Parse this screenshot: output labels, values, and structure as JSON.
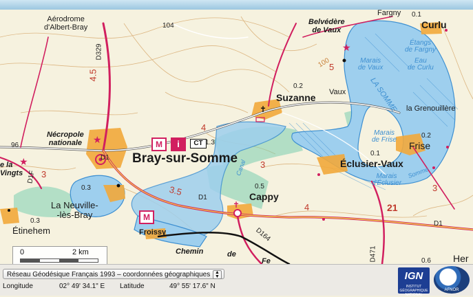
{
  "map": {
    "places": {
      "aerodrome": "Aérodrome\nd'Albert-Bray",
      "fargny": "Fargny",
      "curlu": "Curlu",
      "belvedere": "Belvédère\nde Vaux",
      "etangs_fargny": "Étangs\nde Fargny",
      "eau_curlu": "Eau\nde Curlu",
      "marais_vaux": "Marais\nde Vaux",
      "la_somme": "LA SOMME",
      "vaux": "Vaux",
      "suzanne": "Suzanne",
      "grenouillere": "la Grenouillère",
      "necropole": "Nécropole\nnationale",
      "bray": "Bray-sur-Somme",
      "marais_frise": "Marais\nde Frise",
      "frise": "Frise",
      "eclusier": "Éclusier-Vaux",
      "marais_eclusier": "Marais\nd'Éclusier",
      "vingts": "e la\nVingts",
      "neuville": "La Neuville-\n-lès-Bray",
      "cappy": "Cappy",
      "etinehem": "Étinehem",
      "froissy": "Froissy",
      "chemin": "Chemin",
      "de": "de",
      "fer": "Fe",
      "her": "Her",
      "canal": "Canal",
      "somme_small": "Somme"
    },
    "spot_heights": [
      "104",
      "0.1",
      "0.2",
      "96",
      "1.3",
      "0.5",
      "0.1",
      "0.2",
      "0.3",
      "0.3",
      "0.6"
    ],
    "road_numbers": [
      "D329",
      "D1",
      "D1F",
      "D1",
      "D164",
      "D471",
      "D1",
      "4.5",
      "3.5",
      "3",
      "4",
      "4",
      "5",
      "21",
      "3",
      "3",
      "100"
    ],
    "poi_badges": {
      "m1": "M",
      "i": "i",
      "ct": "CT",
      "m2": "M"
    },
    "scale": {
      "zero": "0",
      "km": "2 km"
    }
  },
  "footer": {
    "crs_select": "Réseau Géodésique Français 1993 – coordonnées géographiques",
    "longitude_label": "Longitude",
    "longitude_value": "02° 49' 34.1\" E",
    "latitude_label": "Latitude",
    "latitude_value": "49° 55' 17.6\" N",
    "ign_logo": "IGN",
    "ign_sub": "INSTITUT\nGÉOGRAPHIQUE\nNATIONAL",
    "logo2_sub": "AFNOR"
  },
  "colors": {
    "water": "#9ecfee",
    "water_edge": "#3d8fd1",
    "paper": "#f6f2df",
    "road_main": "#d11f5f",
    "road_yellow": "#f2d24a",
    "town_orange": "#f2a93b",
    "forest_green": "#7ccfb1",
    "contour": "#d6a76a"
  },
  "icons": [
    "select-arrow-icon",
    "star-icon",
    "church-icon",
    "cross-icon",
    "scale-bar"
  ]
}
